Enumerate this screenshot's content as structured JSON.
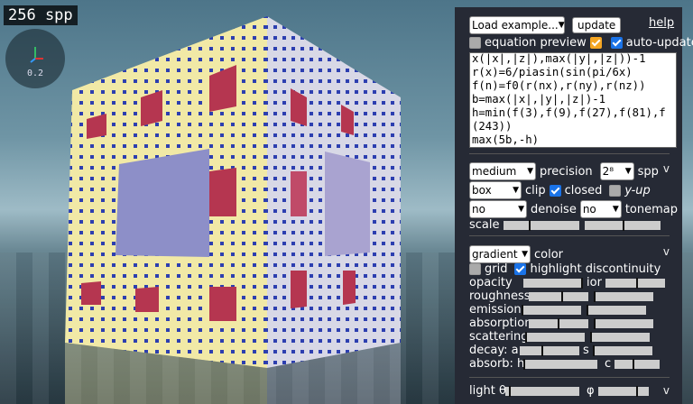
{
  "status": {
    "spp_label": "256 spp",
    "zoom": "0.2"
  },
  "panel": {
    "load_example": "Load example...",
    "update": "update",
    "help": "help",
    "equation_preview": "equation preview",
    "auto_update": "auto-update",
    "code": "x(|x|,|z|),max(|y|,|z|))-1\nr(x)=6/piasin(sin(pi/6x)\nf(n)=f0(r(nx),r(ny),r(nz))\nb=max(|x|,|y|,|z|)-1\nh=min(f(3),f(9),f(27),f(81),f\n(243))\nmax(5b,-h)",
    "precision_value": "medium",
    "precision_label": "precision",
    "spp_value": "2⁸",
    "spp_label": "spp",
    "clip_value": "box",
    "clip_label": "clip",
    "closed_label": "closed",
    "yup_label": "y-up",
    "denoise_value": "no",
    "denoise_label": "denoise",
    "tonemap_value": "no",
    "tonemap_label": "tonemap",
    "scale_label": "scale",
    "color_value": "gradient",
    "color_label": "color",
    "grid_label": "grid",
    "highlight_label": "highlight discontinuity",
    "opacity_label": "opacity",
    "ior_label": "ior",
    "roughness_label": "roughness",
    "emission_label": "emission",
    "absorption_label": "absorption",
    "scattering_label": "scattering",
    "decay_label": "decay: a",
    "s_label": "s",
    "absorb_label": "absorb: h",
    "c_label": "c",
    "light_label": "light θ",
    "omega_label": "φ",
    "chevron": "v"
  }
}
